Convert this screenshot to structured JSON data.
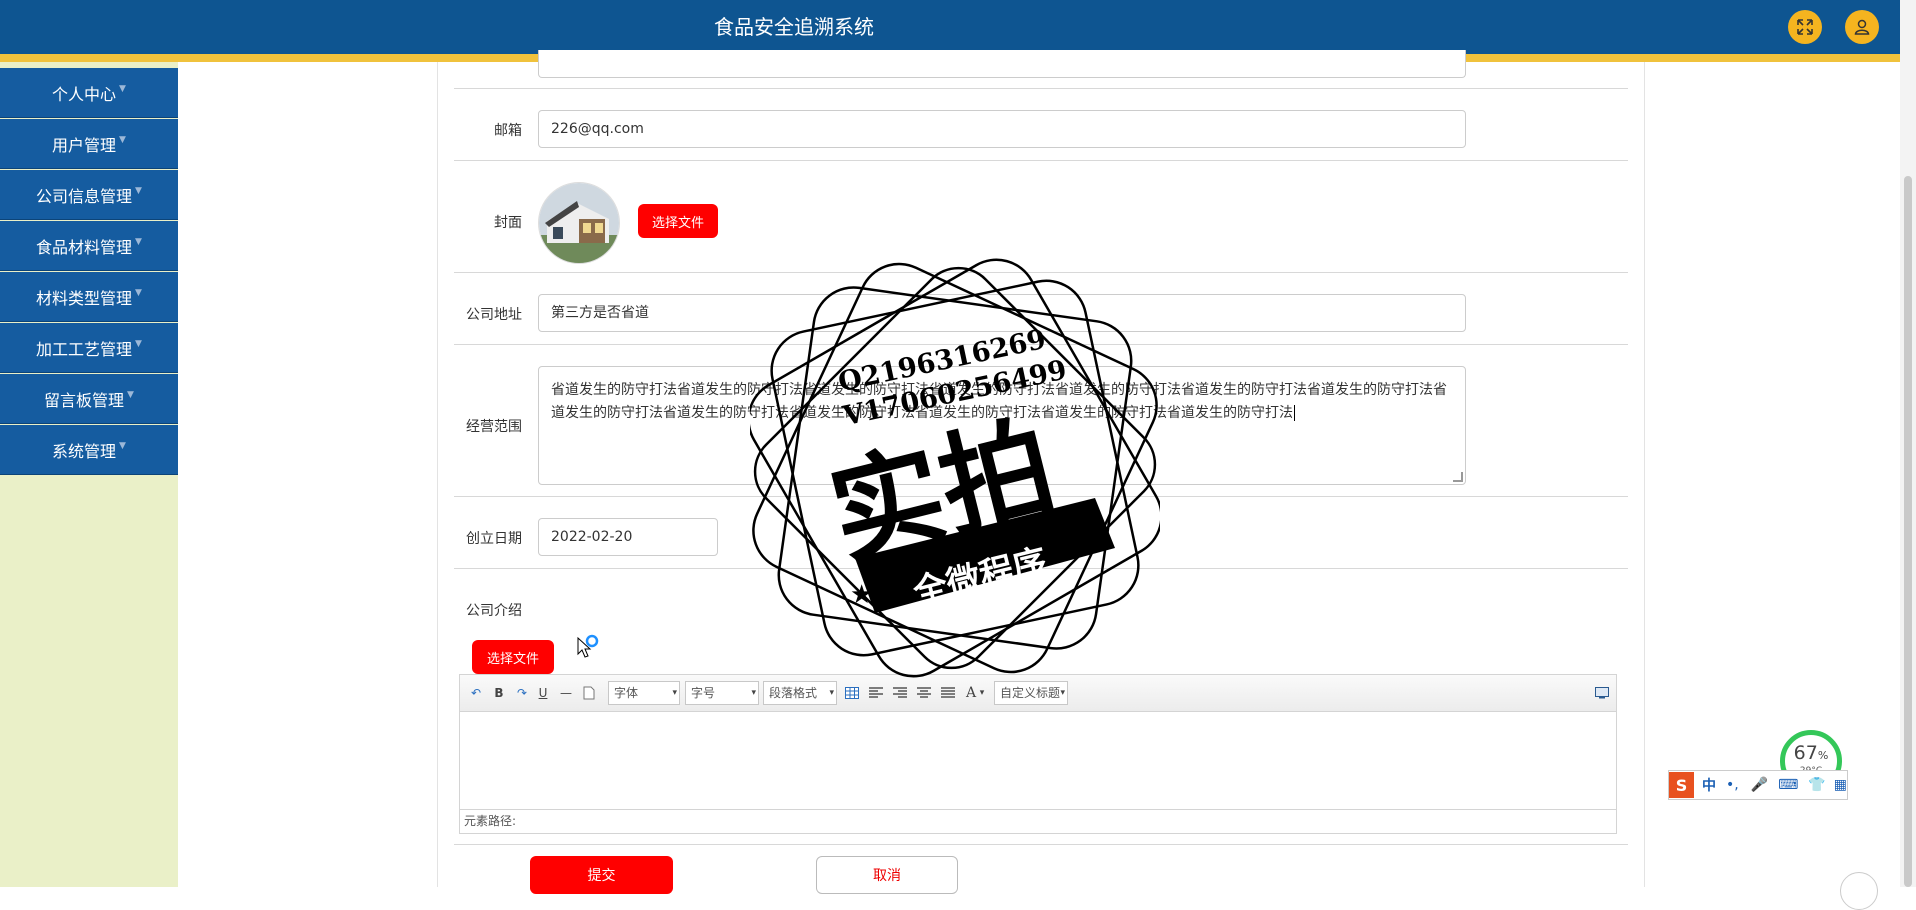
{
  "header": {
    "title": "食品安全追溯系统",
    "expand_icon": "expand-icon",
    "user_icon": "user-icon"
  },
  "sidebar": {
    "items": [
      {
        "label": "个人中心"
      },
      {
        "label": "用户管理"
      },
      {
        "label": "公司信息管理"
      },
      {
        "label": "食品材料管理"
      },
      {
        "label": "材料类型管理"
      },
      {
        "label": "加工工艺管理"
      },
      {
        "label": "留言板管理"
      },
      {
        "label": "系统管理"
      }
    ]
  },
  "form": {
    "email": {
      "label": "邮箱",
      "value": "226@qq.com"
    },
    "cover": {
      "label": "封面",
      "button": "选择文件"
    },
    "address": {
      "label": "公司地址",
      "value": "第三方是否省道"
    },
    "scope": {
      "label": "经营范围",
      "value": "省道发生的防守打法省道发生的防守打法省道发生的防守打法省道发生的防守打法省道发生的防守打法省道发生的防守打法省道发生的防守打法省道发生的防守打法省道发生的防守打法省道发生的防守打法省道发生的防守打法省道发生的防守打法省道发生的防守打法"
    },
    "founded": {
      "label": "创立日期",
      "value": "2022-02-20"
    },
    "intro": {
      "label": "公司介绍",
      "button": "选择文件"
    },
    "submit": "提交",
    "cancel": "取消"
  },
  "editor": {
    "font": "字体",
    "size": "字号",
    "paragraph": "段落格式",
    "custom_title": "自定义标题",
    "bold": "B",
    "underline": "U",
    "color": "A",
    "path_label": "元素路径:"
  },
  "watermark": {
    "qq": "Q2196316269",
    "vx": "V17060256499",
    "main": "实拍",
    "banner": "全微程序"
  },
  "system": {
    "battery_pct": "67",
    "battery_unit": "%",
    "temperature": "29°C",
    "ime_lang": "中"
  }
}
